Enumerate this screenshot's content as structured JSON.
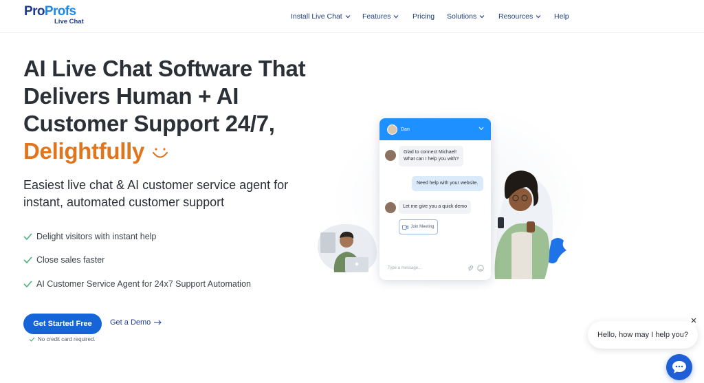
{
  "header": {
    "logo": {
      "main_a": "Pro",
      "main_b": "Profs",
      "sub": "Live Chat"
    },
    "nav": [
      {
        "label": "Install Live Chat",
        "has_dropdown": true
      },
      {
        "label": "Features",
        "has_dropdown": true
      },
      {
        "label": "Pricing",
        "has_dropdown": false
      },
      {
        "label": "Solutions",
        "has_dropdown": true
      },
      {
        "label": "Resources",
        "has_dropdown": true
      },
      {
        "label": "Help",
        "has_dropdown": false
      }
    ]
  },
  "hero": {
    "title_lines": [
      "AI Live Chat Software That",
      "Delivers Human + AI",
      "Customer Support 24/7,"
    ],
    "title_accent": "Delightfully",
    "subtitle": "Easiest live chat & AI customer service agent for instant, automated customer support",
    "features": [
      "Delight visitors with instant help",
      "Close sales faster",
      "AI Customer Service Agent for 24x7 Support Automation"
    ],
    "cta_primary": "Get Started Free",
    "cta_secondary": "Get a Demo",
    "cta_note": "No credit card required."
  },
  "chat_preview": {
    "agent_name": "Dan",
    "messages": [
      {
        "from": "agent",
        "lines": [
          "Glad to connect Michael!",
          "What can I help you with?"
        ]
      },
      {
        "from": "visitor",
        "lines": [
          "Need help with your website."
        ]
      },
      {
        "from": "agent",
        "lines": [
          "Let me give you a quick demo"
        ]
      }
    ],
    "join_button": "Join Meeting",
    "input_placeholder": "Type a message..."
  },
  "widget": {
    "greeting": "Hello, how may I help you?"
  },
  "colors": {
    "brand_dark": "#1d3a8f",
    "brand_blue": "#1e88e5",
    "accent_orange": "#e0751e",
    "primary_button": "#1565d8",
    "check_green": "#4caf7d",
    "chat_header": "#1e90ff"
  }
}
